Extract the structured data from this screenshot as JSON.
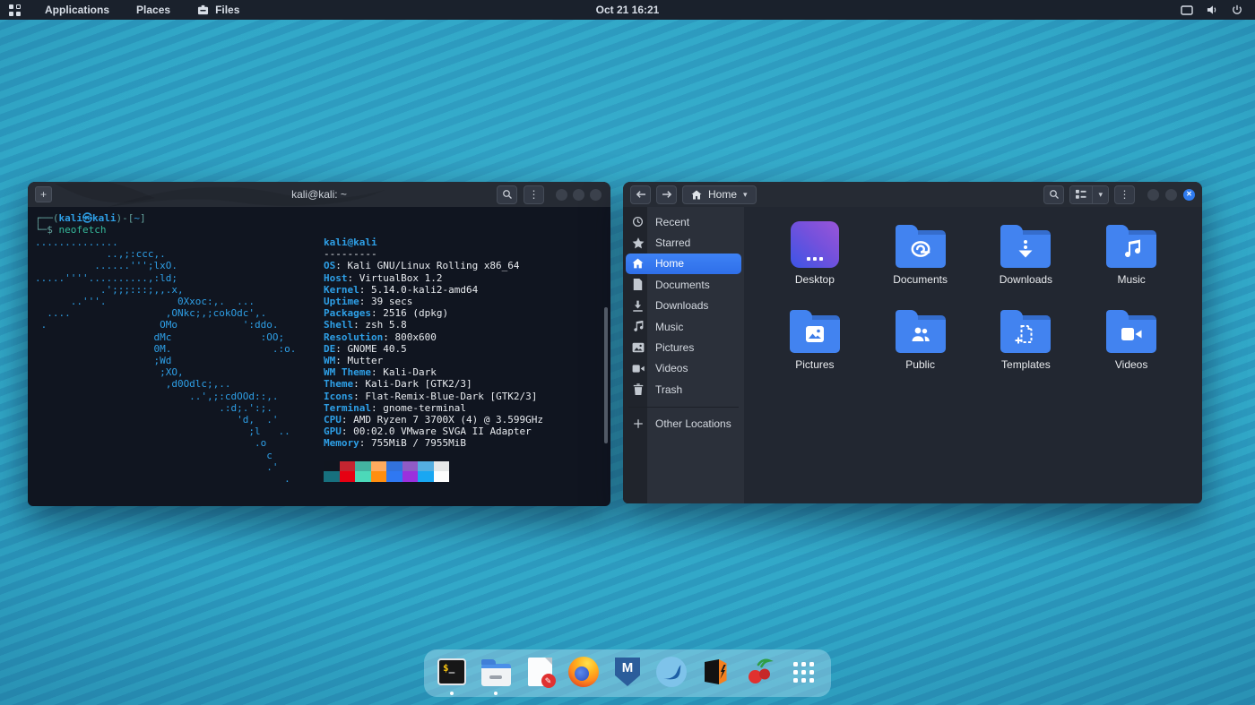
{
  "colors": {
    "accent_blue": "#3584e4",
    "folder_blue": "#4283f0",
    "selection_blue": "#3173f1",
    "terminal_blue": "#2e9fe6"
  },
  "topbar": {
    "menus": [
      {
        "label": "Applications"
      },
      {
        "label": "Places"
      },
      {
        "label": "Files"
      }
    ],
    "clock": "Oct 21 16:21"
  },
  "terminal": {
    "title": "kali@kali: ~",
    "prompt": {
      "frame_open": "┌──(",
      "user_host": "kali㉿kali",
      "frame_mid": ")-[",
      "path": "~",
      "frame_close": "]",
      "frame_line2": "└─$ ",
      "command": "neofetch"
    },
    "ascii_art": "..............\n            ..,;:ccc,.\n          ......''';lxO.\n.....''''..........,:ld;\n           .';;;:::;,,.x,\n      ..'''.            0Xxoc:,.  ...\n  ....                ,ONkc;,;cokOdc',.\n .                   OMo           ':ddo.\n                    dMc               :OO;\n                    0M.                 .:o.\n                    ;Wd\n                     ;XO,\n                      ,d0Odlc;,..\n                          ..',;:cdOOd::,.\n                               .:d;.':;.\n                                  'd,  .'\n                                    ;l   ..\n                                     .o\n                                       c\n                                       .'\n                                          .",
    "neofetch": {
      "title": "kali@kali",
      "underline": "---------",
      "info": [
        {
          "label": "OS",
          "value": "Kali GNU/Linux Rolling x86_64"
        },
        {
          "label": "Host",
          "value": "VirtualBox 1.2"
        },
        {
          "label": "Kernel",
          "value": "5.14.0-kali2-amd64"
        },
        {
          "label": "Uptime",
          "value": "39 secs"
        },
        {
          "label": "Packages",
          "value": "2516 (dpkg)"
        },
        {
          "label": "Shell",
          "value": "zsh 5.8"
        },
        {
          "label": "Resolution",
          "value": "800x600"
        },
        {
          "label": "DE",
          "value": "GNOME 40.5"
        },
        {
          "label": "WM",
          "value": "Mutter"
        },
        {
          "label": "WM Theme",
          "value": "Kali-Dark"
        },
        {
          "label": "Theme",
          "value": "Kali-Dark [GTK2/3]"
        },
        {
          "label": "Icons",
          "value": "Flat-Remix-Blue-Dark [GTK2/3]"
        },
        {
          "label": "Terminal",
          "value": "gnome-terminal"
        },
        {
          "label": "CPU",
          "value": "AMD Ryzen 7 3700X (4) @ 3.599GHz"
        },
        {
          "label": "GPU",
          "value": "00:02.0 VMware SVGA II Adapter"
        },
        {
          "label": "Memory",
          "value": "755MiB / 7955MiB"
        }
      ],
      "palette_row1": [
        "#10151f",
        "#c42530",
        "#43b3a0",
        "#ffab5e",
        "#3272dc",
        "#8f5bc6",
        "#54aee0",
        "#e6e8e8"
      ],
      "palette_row2": [
        "#17707e",
        "#e60012",
        "#4cd9b9",
        "#ff8e10",
        "#2f78f2",
        "#9b30dd",
        "#19a7f2",
        "#fdfdfd"
      ]
    }
  },
  "files": {
    "path_label": "Home",
    "sidebar": [
      {
        "label": "Recent",
        "icon": "recent-icon"
      },
      {
        "label": "Starred",
        "icon": "star-icon"
      },
      {
        "label": "Home",
        "icon": "home-icon",
        "selected": true
      },
      {
        "label": "Documents",
        "icon": "document-icon"
      },
      {
        "label": "Downloads",
        "icon": "download-icon"
      },
      {
        "label": "Music",
        "icon": "music-icon"
      },
      {
        "label": "Pictures",
        "icon": "image-icon"
      },
      {
        "label": "Videos",
        "icon": "video-icon"
      },
      {
        "label": "Trash",
        "icon": "trash-icon"
      },
      {
        "label": "Other Locations",
        "icon": "plus-icon"
      }
    ],
    "folders": [
      {
        "name": "Desktop",
        "icon": "desktop-tile"
      },
      {
        "name": "Documents",
        "icon": "paperclip-icon"
      },
      {
        "name": "Downloads",
        "icon": "download-arrow-icon"
      },
      {
        "name": "Music",
        "icon": "music-note-icon"
      },
      {
        "name": "Pictures",
        "icon": "photo-icon"
      },
      {
        "name": "Public",
        "icon": "people-icon"
      },
      {
        "name": "Templates",
        "icon": "template-icon"
      },
      {
        "name": "Videos",
        "icon": "camera-icon"
      }
    ]
  },
  "dock": {
    "items": [
      "terminal",
      "file-manager",
      "text-editor",
      "firefox",
      "metasploit",
      "wireshark",
      "burpsuite",
      "cherrytree",
      "show-applications"
    ],
    "running": [
      "terminal",
      "file-manager"
    ]
  }
}
